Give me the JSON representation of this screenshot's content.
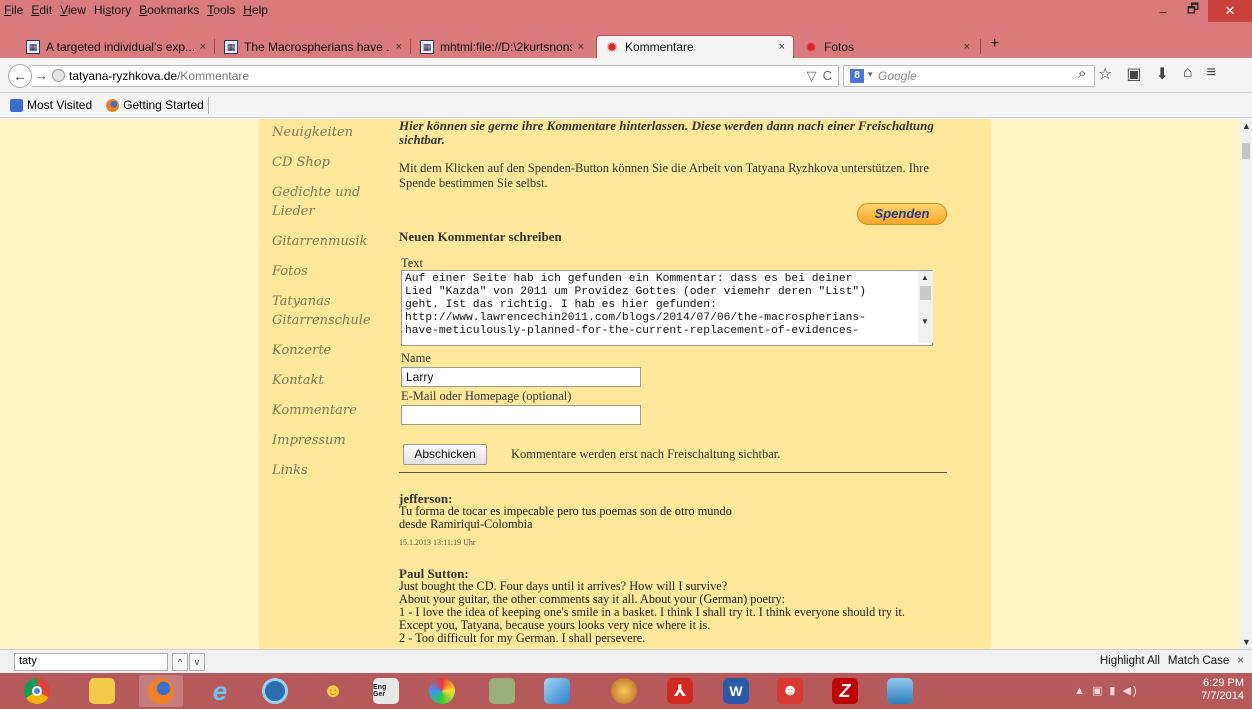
{
  "menu": {
    "items": [
      {
        "pre": "",
        "key": "F",
        "post": "ile"
      },
      {
        "pre": "",
        "key": "E",
        "post": "dit"
      },
      {
        "pre": "",
        "key": "V",
        "post": "iew"
      },
      {
        "pre": "Hi",
        "key": "s",
        "post": "tory"
      },
      {
        "pre": "",
        "key": "B",
        "post": "ookmarks"
      },
      {
        "pre": "",
        "key": "T",
        "post": "ools"
      },
      {
        "pre": "",
        "key": "H",
        "post": "elp"
      }
    ],
    "window_minimize": "–",
    "window_maximize": "🗗",
    "window_close": "✕"
  },
  "tabs": [
    {
      "label": "A targeted individual's exp...",
      "icon": "grid-page-icon"
    },
    {
      "label": "The Macrospherians have ...",
      "icon": "grid-page-icon"
    },
    {
      "label": "mhtml:file://D:\\2kurtsnons...",
      "icon": "grid-page-icon"
    },
    {
      "label": "Kommentare",
      "icon": "gear-favicon-icon",
      "active": true
    },
    {
      "label": "Fotos",
      "icon": "gear-favicon-icon"
    }
  ],
  "tab_close": "×",
  "new_tab": "+",
  "navbar": {
    "back": "←",
    "forward": "→",
    "url_host": "tatyana-ryzhkova.de",
    "url_path": "/Kommentare",
    "reload": "C",
    "dropdown": "▽",
    "search_engine_letter": "8",
    "search_caret": "▾",
    "search_placeholder": "Google",
    "search_icon": "⌕",
    "toolbar": [
      "☆",
      "▣",
      "⬇",
      "⌂",
      "≡"
    ]
  },
  "bookmarks": [
    {
      "label": "Most Visited",
      "icon": "bookmark-folder-icon"
    },
    {
      "label": "Getting Started",
      "icon": "firefox-icon"
    }
  ],
  "sidenav": [
    "Neuigkeiten",
    "CD Shop",
    "Gedichte und Lieder",
    "Gitarrenmusik",
    "Fotos",
    "Tatyanas Gitarrenschule",
    "Konzerte",
    "Kontakt",
    "Kommentare",
    "Impressum",
    "Links"
  ],
  "page": {
    "intro": "Hier können sie gerne ihre Kommentare hinterlassen. Diese werden dann nach einer Freischaltung sichtbar.",
    "donate_text": "Mit dem Klicken auf den Spenden-Button können Sie die Arbeit von Tatyana Ryzhkova unterstützen. Ihre Spende bestimmen Sie selbst.",
    "donate_button": "Spenden",
    "write_heading": "Neuen Kommentar schreiben",
    "text_label": "Text",
    "text_value": "Auf einer Seite hab ich gefunden ein Kommentar: dass es bei deiner\nLied \"Kazda\" von 2011 um Providez Gottes (oder viemehr deren \"List\")\ngeht. Ist das richtig. I hab es hier gefunden:\nhttp://www.lawrencechin2011.com/blogs/2014/07/06/the-macrospherians-\nhave-meticulously-planned-for-the-current-replacement-of-evidences-",
    "name_label": "Name",
    "name_value": "Larry",
    "email_label": "E-Mail oder Homepage (optional)",
    "email_value": "",
    "submit_button": "Abschicken",
    "submit_note": "Kommentare werden erst nach Freischaltung sichtbar."
  },
  "comments": [
    {
      "author": "jefferson:",
      "lines": [
        "Tu forma de tocar es impecable pero tus poemas son de otro mundo",
        "desde Ramiriqui-Colombia"
      ],
      "date": "15.1.2013 13:11:19 Uhr"
    },
    {
      "author": "Paul Sutton:",
      "lines": [
        "Just bought the CD. Four days until it arrives? How will I survive?",
        "About your guitar, the other comments say it all. About your (German) poetry:",
        "1 - I love the idea of keeping one's smile in a basket. I think I shall try it. I think everyone should try it.",
        "Except you, Tatyana, because yours looks very nice where it is.",
        "2 - Too difficult for my German. I shall persevere."
      ],
      "date": ""
    }
  ],
  "findbar": {
    "query": "taty",
    "prev": "^",
    "next": "v",
    "highlight_all": "Highlight All",
    "match_case": "Match Case",
    "close": "×"
  },
  "taskbar": {
    "apps": [
      "chrome-icon",
      "file-explorer-icon",
      "firefox-icon",
      "internet-explorer-icon",
      "media-icon",
      "people-icon",
      "dictionary-icon",
      "paint-icon",
      "remote-icon",
      "notes-icon",
      "globe-icon",
      "acrobat-icon",
      "word-icon",
      "presenter-icon",
      "filezilla-icon",
      "photos-icon"
    ],
    "dict_label": "Eng Ger",
    "tray": "▲ ▣ ▮ ◀)",
    "time": "6:29 PM",
    "date": "7/7/2014"
  },
  "colors": {
    "chrome_accent": "#d97a7c",
    "taskbar": "#b5595b",
    "page_background": "#fff5c6",
    "content_column": "#ffe89a",
    "donate_button": "#f7a72a"
  }
}
